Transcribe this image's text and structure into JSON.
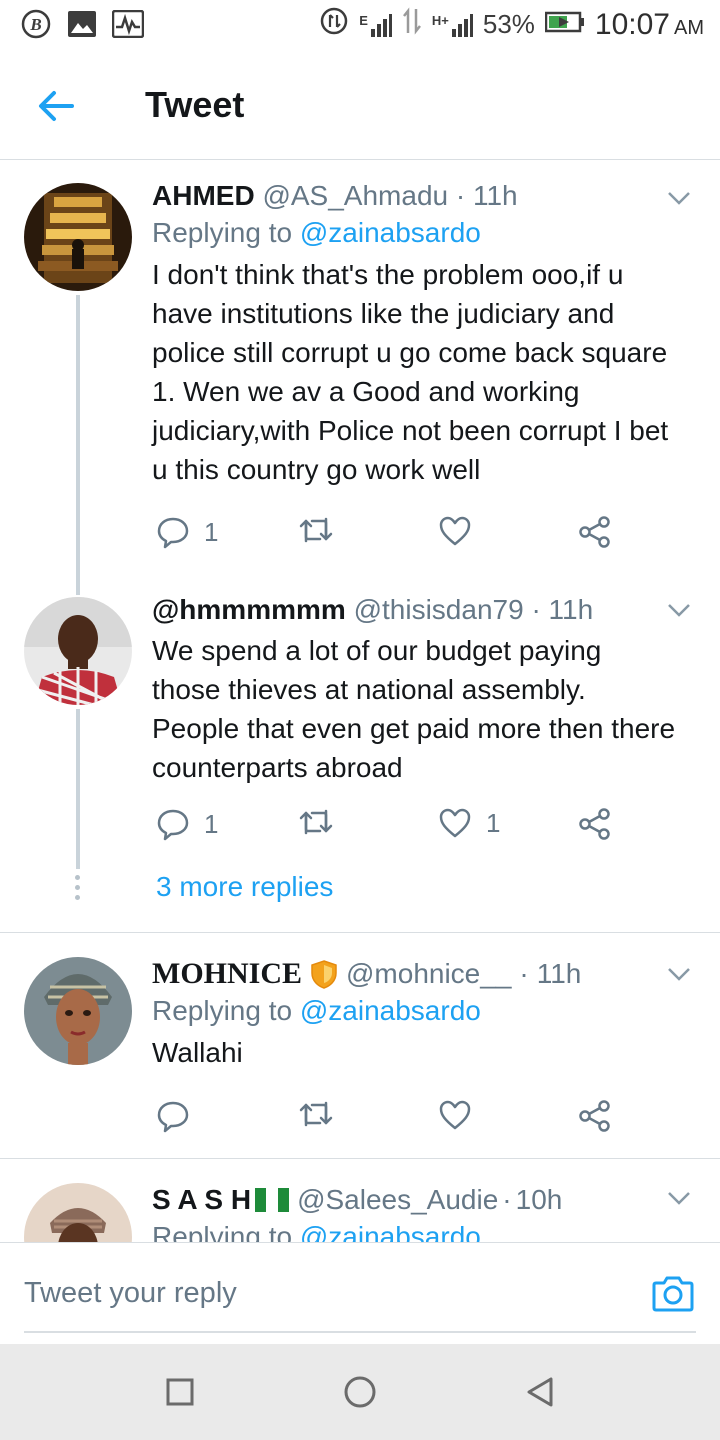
{
  "status_bar": {
    "icons_left": [
      "b-circle-icon",
      "image-icon",
      "activity-icon"
    ],
    "icons_right": [
      "data-saver-icon",
      "signal-e-icon",
      "data-arrows-icon",
      "signal-h-icon"
    ],
    "net_e": "E",
    "net_h": "H+",
    "battery": "53%",
    "time": "10:07",
    "ampm": "AM"
  },
  "header": {
    "title": "Tweet"
  },
  "tweets": [
    {
      "name": "AHMED",
      "handle": "@AS_Ahmadu",
      "dot": "·",
      "time": "11h",
      "replying_prefix": "Replying to",
      "replying_to": "@zainabsardo",
      "text": "I don't think that's the problem ooo,if u have institutions like the judiciary and police still corrupt u go come back square 1. Wen we av a Good and working judiciary,with Police not been corrupt I bet u this country go work well",
      "replies": "1",
      "retweets": "",
      "likes": ""
    },
    {
      "name": "@hmmmmmm",
      "handle": "@thisisdan79",
      "dot": "·",
      "time": "11h",
      "text": "We spend a lot of our budget paying those thieves at national assembly. People that even get paid more then there counterparts abroad",
      "replies": "1",
      "retweets": "",
      "likes": "1"
    },
    {
      "name": "MOHNICE",
      "badge_icon": "shield-icon",
      "handle": "@mohnice__",
      "dot": "·",
      "time": "11h",
      "replying_prefix": "Replying to",
      "replying_to": "@zainabsardo",
      "text": "Wallahi",
      "replies": "",
      "retweets": "",
      "likes": ""
    },
    {
      "name": "S A S H",
      "flag_icon": "nigeria-flag-icon",
      "handle": "@Salees_Audie",
      "dot": "·",
      "time": "10h",
      "replying_prefix": "Replying to",
      "replying_to": "@zainabsardo"
    }
  ],
  "thread": {
    "more_replies": "3 more replies"
  },
  "composer": {
    "placeholder": "Tweet your reply"
  },
  "colors": {
    "accent": "#1da1f2",
    "muted": "#657786",
    "text": "#14171a",
    "divider": "#d9dee2"
  }
}
